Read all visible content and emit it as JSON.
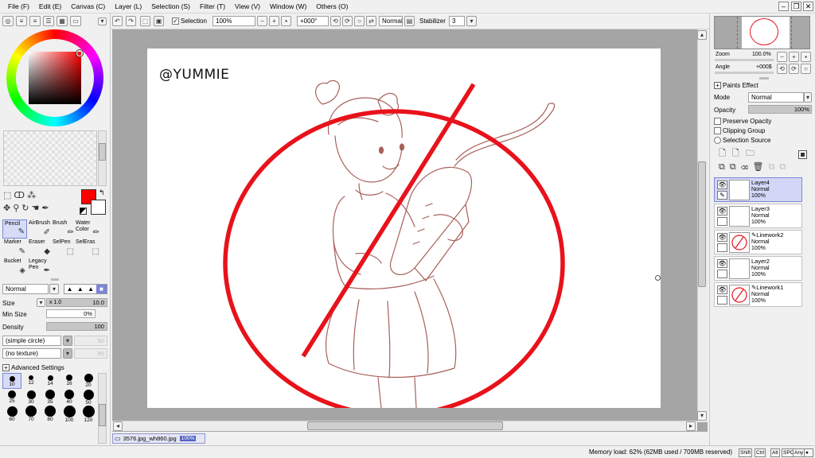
{
  "menu": [
    "File (F)",
    "Edit (E)",
    "Canvas (C)",
    "Layer (L)",
    "Selection (S)",
    "Filter (T)",
    "View (V)",
    "Window (W)",
    "Others (O)"
  ],
  "toolbar": {
    "selection_label": "Selection",
    "zoom_value": "100%",
    "rotate_value": "+000°",
    "blend_value": "Normal",
    "stabilizer_label": "Stabilizer",
    "stabilizer_value": "3"
  },
  "tools": [
    {
      "label": "Pencil",
      "icon": "pencil-icon"
    },
    {
      "label": "AirBrush",
      "icon": "airbrush-icon"
    },
    {
      "label": "Brush",
      "icon": "brush-icon"
    },
    {
      "label": "Water Color",
      "icon": "watercolor-icon"
    },
    {
      "label": "Marker",
      "icon": "marker-icon"
    },
    {
      "label": "Eraser",
      "icon": "eraser-icon"
    },
    {
      "label": "SelPen",
      "icon": "selpen-icon"
    },
    {
      "label": "SelEras",
      "icon": "seleras-icon"
    },
    {
      "label": "Bucket",
      "icon": "bucket-icon"
    },
    {
      "label": "Legacy Pen",
      "icon": "legacy-pen-icon"
    }
  ],
  "brush_settings": {
    "blend": "Normal",
    "size_label": "Size",
    "size_multiplier": "x 1.0",
    "size_value": "10.0",
    "min_size_label": "Min Size",
    "min_size_value": "0%",
    "density_label": "Density",
    "density_value": "100",
    "shape": "(simple circle)",
    "shape_value": "50",
    "texture": "(no texture)",
    "texture_value": "95",
    "advanced_label": "Advanced Settings"
  },
  "brush_sizes": [
    "10",
    "12",
    "14",
    "16",
    "20",
    "25",
    "30",
    "35",
    "40",
    "50",
    "60",
    "70",
    "80",
    "100",
    "120"
  ],
  "canvas": {
    "watermark": "@YUMMIE",
    "tab_name": "3576.jpg_wh860.jpg",
    "tab_zoom": "100%"
  },
  "navigator": {
    "zoom_label": "Zoom",
    "zoom_value": "100.0%",
    "angle_label": "Angle",
    "angle_value": "+000$"
  },
  "layer_panel": {
    "paints_effect": "Paints Effect",
    "mode_label": "Mode",
    "mode_value": "Normal",
    "opacity_label": "Opacity",
    "opacity_value": "100%",
    "preserve_opacity": "Preserve Opacity",
    "clipping_group": "Clipping Group",
    "selection_source": "Selection Source"
  },
  "layers": [
    {
      "name": "Layer4",
      "mode": "Normal",
      "opacity": "100%",
      "selected": true,
      "linework": false
    },
    {
      "name": "Layer3",
      "mode": "Normal",
      "opacity": "100%",
      "selected": false,
      "linework": false
    },
    {
      "name": "Linework2",
      "mode": "Normal",
      "opacity": "100%",
      "selected": false,
      "linework": true
    },
    {
      "name": "Layer2",
      "mode": "Normal",
      "opacity": "100%",
      "selected": false,
      "linework": false
    },
    {
      "name": "Linework1",
      "mode": "Normal",
      "opacity": "100%",
      "selected": false,
      "linework": true
    }
  ],
  "status": {
    "memory": "Memory load: 62% (62MB used / 709MB reserved)",
    "keys": [
      "Shift",
      "Ctrl",
      "Alt",
      "SPC",
      "Any"
    ]
  },
  "colors": {
    "primary": "#ff0000",
    "secondary": "#ffffff",
    "prohibition_red": "#e8121b",
    "sketch_line": "#a8605a",
    "selection_highlight": "#d6dbf7"
  }
}
